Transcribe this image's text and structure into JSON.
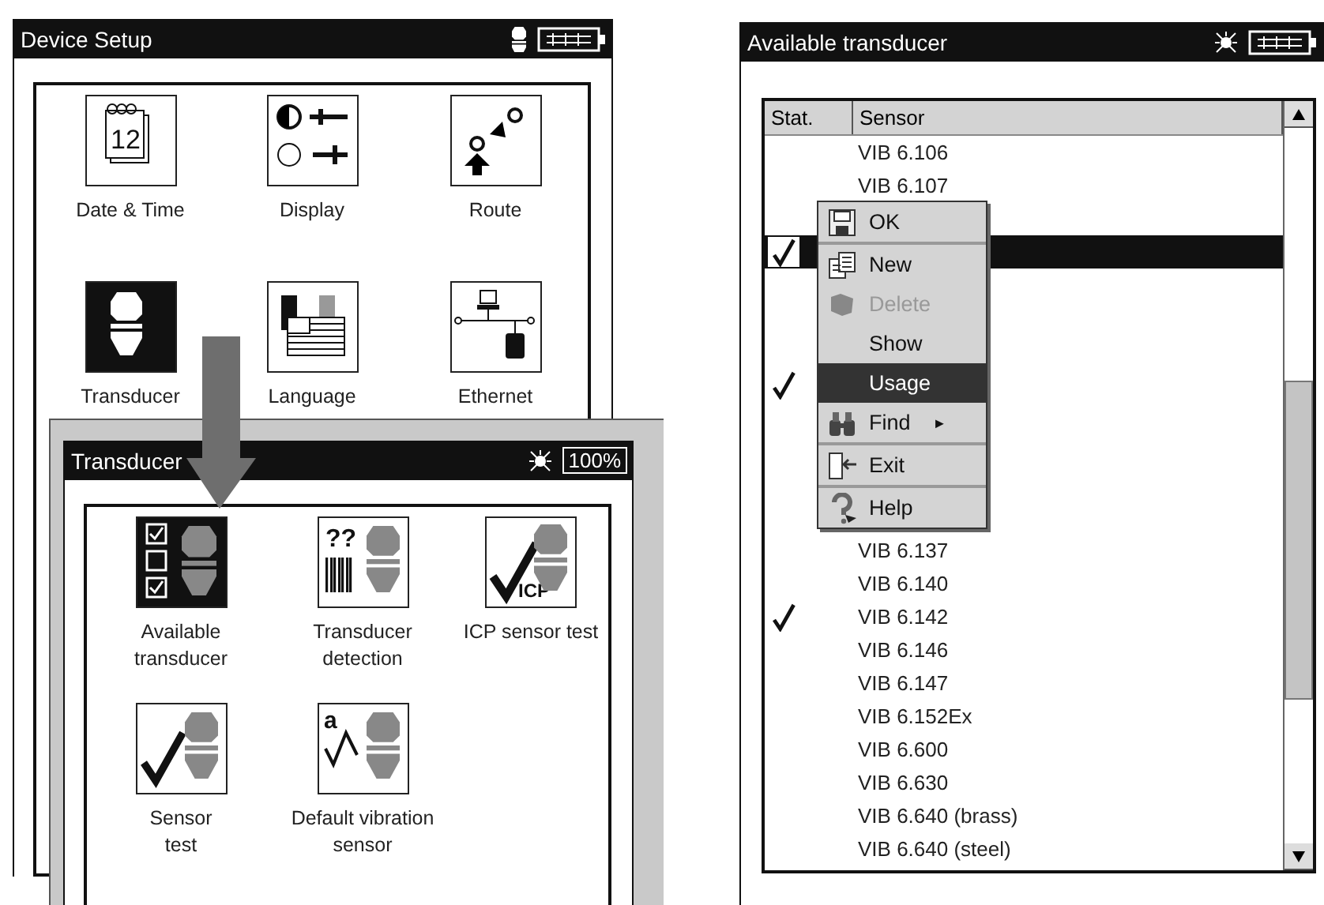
{
  "device_setup": {
    "title": "Device Setup",
    "items": [
      {
        "label": "Date & Time",
        "kind": "calendar",
        "badge": "12",
        "selected": false
      },
      {
        "label": "Display",
        "kind": "display",
        "selected": false
      },
      {
        "label": "Route",
        "kind": "route",
        "selected": false
      },
      {
        "label": "Transducer",
        "kind": "transducer",
        "selected": true
      },
      {
        "label": "Language",
        "kind": "language",
        "selected": false
      },
      {
        "label": "Ethernet",
        "kind": "ethernet",
        "selected": false
      }
    ]
  },
  "transducer": {
    "title": "Transducer",
    "battery": "100%",
    "items": [
      {
        "label": "Available\ntransducer",
        "kind": "available",
        "selected": true
      },
      {
        "label": "Transducer\ndetection",
        "kind": "detection",
        "badge": "??",
        "selected": false
      },
      {
        "label": "ICP sensor test",
        "kind": "icp",
        "badge": "ICP",
        "selected": false
      },
      {
        "label": "Sensor\ntest",
        "kind": "sensor-test",
        "selected": false
      },
      {
        "label": "Default vibration\nsensor",
        "kind": "default-sensor",
        "badge": "a",
        "selected": false
      }
    ]
  },
  "available_transducer": {
    "title": "Available transducer",
    "columns": [
      "Stat.",
      "Sensor"
    ],
    "rows": [
      {
        "sensor": "VIB 6.106",
        "checked": false,
        "selected": false
      },
      {
        "sensor": "VIB 6.107",
        "checked": false,
        "selected": false
      },
      {},
      {
        "checked": true,
        "selected": true
      },
      {},
      {},
      {},
      {
        "checked": true,
        "selected": false
      },
      {},
      {},
      {},
      {},
      {
        "sensor": "VIB 6.137",
        "checked": false,
        "selected": false
      },
      {
        "sensor": "VIB 6.140",
        "checked": false,
        "selected": false
      },
      {
        "sensor": "VIB 6.142",
        "checked": true,
        "selected": false
      },
      {
        "sensor": "VIB 6.146",
        "checked": false,
        "selected": false
      },
      {
        "sensor": "VIB 6.147",
        "checked": false,
        "selected": false
      },
      {
        "sensor": "VIB 6.152Ex",
        "checked": false,
        "selected": false
      },
      {
        "sensor": "VIB 6.600",
        "checked": false,
        "selected": false
      },
      {
        "sensor": "VIB 6.630",
        "checked": false,
        "selected": false
      },
      {
        "sensor": "VIB 6.640 (brass)",
        "checked": false,
        "selected": false
      },
      {
        "sensor": "VIB 6.640 (steel)",
        "checked": false,
        "selected": false
      }
    ],
    "menu": [
      {
        "label": "OK",
        "kind": "save",
        "disabled": false,
        "selected": false,
        "separator": true
      },
      {
        "label": "New",
        "kind": "new",
        "disabled": false,
        "selected": false
      },
      {
        "label": "Delete",
        "kind": "delete",
        "disabled": true,
        "selected": false
      },
      {
        "label": "Show",
        "kind": "plain",
        "disabled": false,
        "selected": false
      },
      {
        "label": "Usage",
        "kind": "plain",
        "disabled": false,
        "selected": true
      },
      {
        "label": "Find",
        "kind": "find",
        "submenu": "►",
        "disabled": false,
        "selected": false,
        "separator": true
      },
      {
        "label": "Exit",
        "kind": "exit",
        "disabled": false,
        "selected": false,
        "separator": true
      },
      {
        "label": "Help",
        "kind": "help",
        "disabled": false,
        "selected": false
      }
    ]
  }
}
